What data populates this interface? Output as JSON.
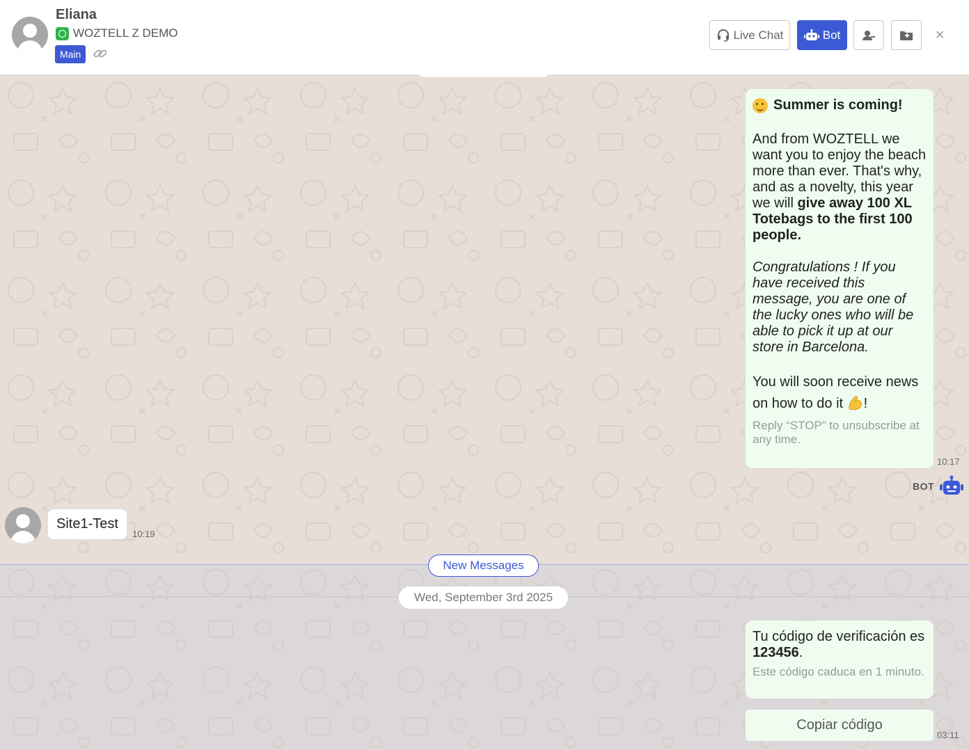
{
  "header": {
    "contact_name": "Eliana",
    "channel_name": "WOZTELL Z DEMO",
    "badge": "Main",
    "buttons": {
      "live_chat": "Live Chat",
      "bot": "Bot"
    },
    "close": "×"
  },
  "messages": {
    "promo": {
      "title": "Summer is coming!",
      "p1_text": "And from WOZTELL we want you to enjoy the beach more than ever. That's why, and as a novelty, this year we will",
      "p1_bold": "give away 100 XL Totebags to the first 100 people.",
      "p2_italic": "Congratulations ! If you have received this message, you are one of the lucky ones who will be able to pick it up at our store in Barcelona.",
      "p3_text": "You will soon receive news on how to do it",
      "p3_end": "!",
      "footer": "Reply “STOP” to unsubscribe at any time.",
      "time": "10:17",
      "sender_tag": "BOT"
    },
    "incoming": {
      "text": "Site1-Test",
      "time": "10:19"
    },
    "new_messages_label": "New Messages",
    "date_label": "Wed, September 3rd 2025",
    "verification": {
      "text_before": "Tu código de verificación es",
      "code": "123456",
      "text_after": ".",
      "footer": "Este código caduca en 1 minuto.",
      "button": "Copiar código",
      "time": "03:11"
    }
  },
  "colors": {
    "accent": "#3d5ad6",
    "whatsapp": "#2fb34a",
    "outgoing_bubble": "#eefdf0",
    "chat_bg": "#e6ded7"
  }
}
